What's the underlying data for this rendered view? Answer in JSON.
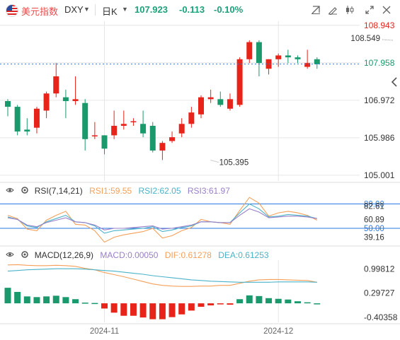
{
  "header": {
    "instrument_name": "美元指数",
    "symbol": "DXY",
    "timeframe": "日K",
    "price": "107.923",
    "change": "-0.113",
    "change_pct": "-0.10%",
    "icons": [
      "flag-icon",
      "caret-down-icon",
      "caret-down-icon",
      "crosshair-icon",
      "draw-icon",
      "candle-type-icon",
      "expand-icon",
      "close-icon",
      "collapse-left-icon"
    ]
  },
  "colors": {
    "up": "#e8231a",
    "down": "#1a9a6c",
    "accent_blue": "#2a7ae2",
    "grid": "#e6e6e6",
    "axis_text": "#333333",
    "price_tag": "#e8231a",
    "rsi1": "#f5a05a",
    "rsi2": "#4ab3c8",
    "rsi3": "#9a7fc8",
    "macd_dif": "#f5a05a",
    "macd_dea": "#4ab3c8",
    "macd_label": "#9a7fc8"
  },
  "chart_data": [
    {
      "type": "candlestick",
      "y_ticks": [
        "108.943",
        "107.958",
        "106.972",
        "105.986",
        "105.001"
      ],
      "ylim": [
        104.85,
        109.05
      ],
      "x_ticks": [
        {
          "label": "2024-11",
          "index": 10
        },
        {
          "label": "2024-12",
          "index": 28
        }
      ],
      "annotations": [
        {
          "label": "108.549",
          "index": 40,
          "value": 108.549
        },
        {
          "label": "105.395",
          "index": 21,
          "value": 105.395
        }
      ],
      "current_price": 107.923,
      "candles": [
        {
          "o": 106.95,
          "h": 107.0,
          "l": 106.55,
          "c": 106.8
        },
        {
          "o": 106.8,
          "h": 106.85,
          "l": 106.05,
          "c": 106.15
        },
        {
          "o": 106.2,
          "h": 106.5,
          "l": 106.05,
          "c": 106.15
        },
        {
          "o": 106.25,
          "h": 106.8,
          "l": 106.1,
          "c": 106.75
        },
        {
          "o": 106.7,
          "h": 107.2,
          "l": 106.5,
          "c": 107.15
        },
        {
          "o": 107.15,
          "h": 107.95,
          "l": 107.05,
          "c": 107.6
        },
        {
          "o": 107.05,
          "h": 107.25,
          "l": 106.5,
          "c": 106.95
        },
        {
          "o": 106.95,
          "h": 107.6,
          "l": 106.85,
          "c": 107.0
        },
        {
          "o": 106.9,
          "h": 107.0,
          "l": 105.65,
          "c": 105.95
        },
        {
          "o": 106.05,
          "h": 106.4,
          "l": 105.95,
          "c": 106.05
        },
        {
          "o": 106.05,
          "h": 106.05,
          "l": 105.55,
          "c": 105.7
        },
        {
          "o": 106.05,
          "h": 106.7,
          "l": 105.95,
          "c": 106.3
        },
        {
          "o": 106.3,
          "h": 106.7,
          "l": 106.2,
          "c": 106.35
        },
        {
          "o": 106.4,
          "h": 106.5,
          "l": 106.3,
          "c": 106.42
        },
        {
          "o": 106.35,
          "h": 106.7,
          "l": 106.0,
          "c": 106.1
        },
        {
          "o": 106.3,
          "h": 106.4,
          "l": 105.6,
          "c": 105.65
        },
        {
          "o": 105.65,
          "h": 105.9,
          "l": 105.4,
          "c": 105.85
        },
        {
          "o": 105.9,
          "h": 106.15,
          "l": 105.85,
          "c": 106.0
        },
        {
          "o": 106.1,
          "h": 106.5,
          "l": 106.0,
          "c": 106.35
        },
        {
          "o": 106.35,
          "h": 106.8,
          "l": 106.25,
          "c": 106.65
        },
        {
          "o": 106.6,
          "h": 107.1,
          "l": 106.5,
          "c": 107.05
        },
        {
          "o": 107.0,
          "h": 107.25,
          "l": 106.9,
          "c": 107.05
        },
        {
          "o": 107.0,
          "h": 107.2,
          "l": 106.8,
          "c": 106.85
        },
        {
          "o": 106.75,
          "h": 107.15,
          "l": 106.7,
          "c": 107.0
        },
        {
          "o": 106.85,
          "h": 108.1,
          "l": 106.8,
          "c": 108.05
        },
        {
          "o": 108.05,
          "h": 108.55,
          "l": 107.95,
          "c": 108.5
        },
        {
          "o": 108.5,
          "h": 108.55,
          "l": 107.6,
          "c": 107.95
        },
        {
          "o": 107.8,
          "h": 108.05,
          "l": 107.65,
          "c": 108.05
        },
        {
          "o": 108.05,
          "h": 108.2,
          "l": 107.85,
          "c": 108.15
        },
        {
          "o": 108.15,
          "h": 108.3,
          "l": 107.95,
          "c": 108.1
        },
        {
          "o": 108.1,
          "h": 108.15,
          "l": 107.95,
          "c": 108.05
        },
        {
          "o": 107.85,
          "h": 108.3,
          "l": 107.8,
          "c": 107.95
        },
        {
          "o": 108.05,
          "h": 108.1,
          "l": 107.8,
          "c": 107.92
        }
      ]
    },
    {
      "type": "line",
      "title": "RSI(7,14,21)",
      "labels": [
        "RSI1:59.55",
        "RSI2:62.05",
        "RSI3:61.97"
      ],
      "y_ticks": [
        "80.00",
        "82.61",
        "60.89",
        "50.00",
        "39.16"
      ],
      "ylim": [
        30,
        90
      ],
      "ref_lines": [
        80,
        50
      ],
      "series": [
        {
          "name": "RSI1",
          "values": [
            66,
            62,
            49,
            47,
            60,
            66,
            71,
            55,
            54,
            47,
            33,
            39,
            42,
            44,
            46,
            50,
            38,
            41,
            47,
            51,
            61,
            58,
            57,
            55,
            72,
            88,
            81,
            65,
            69,
            71,
            69,
            66,
            60
          ]
        },
        {
          "name": "RSI2",
          "values": [
            64,
            61,
            53,
            51,
            58,
            62,
            66,
            58,
            57,
            53,
            44,
            47,
            48,
            49,
            50,
            52,
            46,
            48,
            51,
            53,
            58,
            58,
            57,
            57,
            69,
            80,
            74,
            64,
            65,
            67,
            66,
            65,
            62
          ]
        },
        {
          "name": "RSI3",
          "values": [
            63,
            61,
            54,
            52,
            57,
            60,
            63,
            58,
            57,
            54,
            48,
            50,
            50,
            51,
            52,
            53,
            49,
            50,
            52,
            54,
            58,
            58,
            57,
            57,
            66,
            74,
            70,
            63,
            64,
            65,
            65,
            64,
            62
          ]
        }
      ]
    },
    {
      "type": "bar",
      "title": "MACD(12,26,9)",
      "labels": [
        "MACD:0.00050",
        "DIF:0.61278",
        "DEA:0.61253"
      ],
      "y_ticks": [
        "0.99812",
        "0.29727",
        "-0.40358"
      ],
      "ylim": [
        -0.55,
        1.25
      ],
      "x_ticks": [
        {
          "label": "2024-11",
          "index": 10
        },
        {
          "label": "2024-12",
          "index": 28
        }
      ],
      "series": [
        {
          "name": "MACD",
          "values": [
            0.45,
            0.33,
            0.2,
            0.18,
            0.2,
            0.22,
            0.18,
            0.12,
            0.02,
            0.01,
            -0.15,
            -0.27,
            -0.36,
            -0.36,
            -0.41,
            -0.46,
            -0.46,
            -0.4,
            -0.32,
            -0.21,
            -0.1,
            -0.06,
            -0.03,
            -0.04,
            0.12,
            0.23,
            0.21,
            0.15,
            0.13,
            0.11,
            0.06,
            0.03,
            0.0005
          ]
        },
        {
          "name": "DIF",
          "values": [
            1.11,
            1.12,
            1.1,
            1.09,
            1.09,
            1.1,
            1.09,
            1.07,
            1.01,
            0.97,
            0.89,
            0.83,
            0.77,
            0.7,
            0.63,
            0.56,
            0.52,
            0.5,
            0.49,
            0.49,
            0.5,
            0.5,
            0.52,
            0.52,
            0.58,
            0.64,
            0.68,
            0.69,
            0.69,
            0.68,
            0.67,
            0.66,
            0.61
          ]
        },
        {
          "name": "DEA",
          "values": [
            0.93,
            0.95,
            0.97,
            0.98,
            0.99,
            1.0,
            1.0,
            1.0,
            0.99,
            0.97,
            0.95,
            0.93,
            0.9,
            0.87,
            0.84,
            0.8,
            0.77,
            0.74,
            0.71,
            0.68,
            0.66,
            0.64,
            0.63,
            0.62,
            0.61,
            0.61,
            0.61,
            0.61,
            0.62,
            0.62,
            0.62,
            0.62,
            0.61
          ]
        }
      ]
    }
  ]
}
